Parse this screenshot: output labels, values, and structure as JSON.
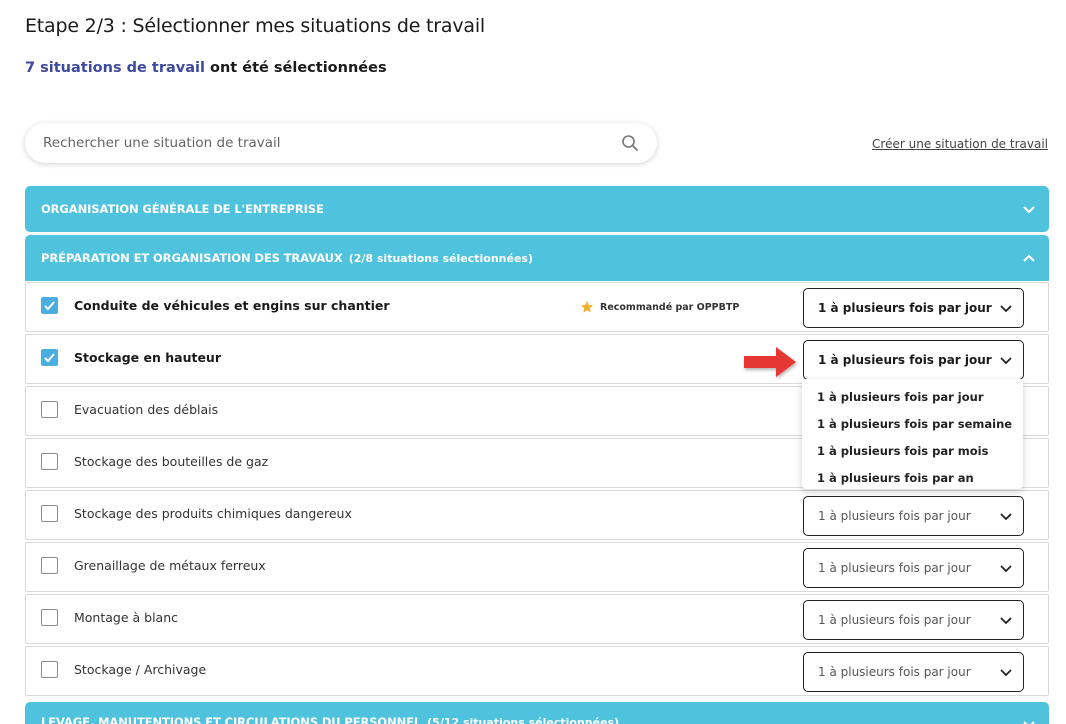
{
  "page": {
    "title": "Etape 2/3 : Sélectionner mes situations de travail",
    "selected_count_text": "7 situations de travail",
    "selected_suffix": " ont été sélectionnées"
  },
  "search": {
    "placeholder": "Rechercher une situation de travail",
    "icon": "search-icon"
  },
  "create_link": "Créer une situation de travail",
  "sections": [
    {
      "title": "ORGANISATION GÉNÉRALE DE L'ENTREPRISE",
      "count": "",
      "expanded": false
    },
    {
      "title": "PRÉPARATION ET ORGANISATION DES TRAVAUX",
      "count": "(2/8 situations sélectionnées)",
      "expanded": true
    },
    {
      "title": "LEVAGE, MANUTENTIONS ET CIRCULATIONS DU PERSONNEL",
      "count": "(5/12 situations sélectionnées)",
      "expanded": false
    }
  ],
  "rows": [
    {
      "label": "Conduite de véhicules et engins sur chantier",
      "checked": true,
      "recommended": "Recommandé par OPPBTP",
      "frequency": "1 à plusieurs fois par jour"
    },
    {
      "label": "Stockage en hauteur",
      "checked": true,
      "recommended": "",
      "frequency": "1 à plusieurs fois par jour"
    },
    {
      "label": "Evacuation des déblais",
      "checked": false,
      "recommended": "",
      "frequency": ""
    },
    {
      "label": "Stockage des bouteilles de gaz",
      "checked": false,
      "recommended": "",
      "frequency": ""
    },
    {
      "label": "Stockage des produits chimiques dangereux",
      "checked": false,
      "recommended": "",
      "frequency": "1 à plusieurs fois par jour"
    },
    {
      "label": "Grenaillage de métaux ferreux",
      "checked": false,
      "recommended": "",
      "frequency": "1 à plusieurs fois par jour"
    },
    {
      "label": "Montage à blanc",
      "checked": false,
      "recommended": "",
      "frequency": "1 à plusieurs fois par jour"
    },
    {
      "label": "Stockage / Archivage",
      "checked": false,
      "recommended": "",
      "frequency": "1 à plusieurs fois par jour"
    }
  ],
  "dropdown_options": [
    "1 à plusieurs fois par jour",
    "1 à plusieurs fois par semaine",
    "1 à plusieurs fois par mois",
    "1 à plusieurs fois par an"
  ],
  "colors": {
    "section_bg": "#4fc3dd",
    "accent_text": "#3e4a9e",
    "checkbox_checked": "#4aaee0",
    "star": "#f2b230",
    "arrow": "#e53935"
  }
}
